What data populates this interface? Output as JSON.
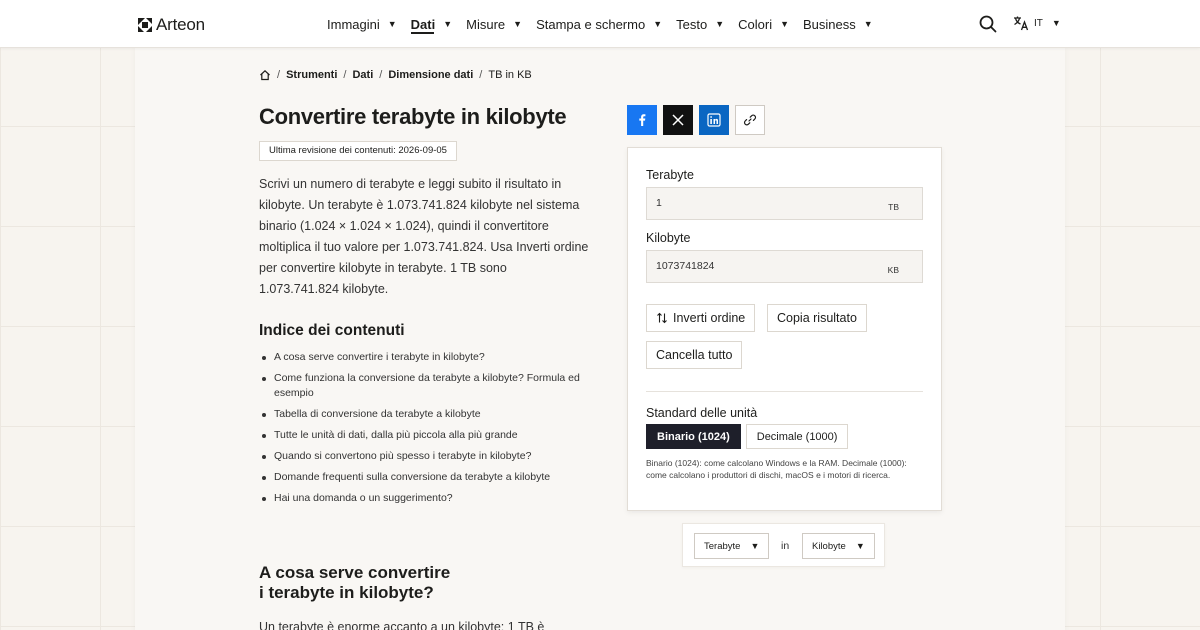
{
  "header": {
    "logo_text": "Arteon",
    "nav": [
      {
        "label": "Immagini",
        "active": false
      },
      {
        "label": "Dati",
        "active": true
      },
      {
        "label": "Misure",
        "active": false
      },
      {
        "label": "Stampa e schermo",
        "active": false
      },
      {
        "label": "Testo",
        "active": false
      },
      {
        "label": "Colori",
        "active": false
      },
      {
        "label": "Business",
        "active": false
      }
    ],
    "language": "IT"
  },
  "breadcrumb": {
    "items": [
      "Strumenti",
      "Dati",
      "Dimensione dati"
    ],
    "current": "TB in KB"
  },
  "page_title": "Convertire terabyte in kilobyte",
  "revision": "Ultima revisione dei contenuti: 2026-09-05",
  "intro": "Scrivi un numero di terabyte e leggi subito il risultato in kilobyte. Un terabyte è 1.073.741.824 kilobyte nel sistema binario (1.024 × 1.024 × 1.024), quindi il convertitore moltiplica il tuo valore per 1.073.741.824. Usa Inverti ordine per convertire kilobyte in terabyte. 1 TB sono 1.073.741.824 kilobyte.",
  "toc": {
    "title": "Indice dei contenuti",
    "items": [
      "A cosa serve convertire i terabyte in kilobyte?",
      "Come funziona la conversione da terabyte a kilobyte? Formula ed esempio",
      "Tabella di conversione da terabyte a kilobyte",
      "Tutte le unità di dati, dalla più piccola alla più grande",
      "Quando si convertono più spesso i terabyte in kilobyte?",
      "Domande frequenti sulla conversione da terabyte a kilobyte",
      "Hai una domanda o un suggerimento?"
    ]
  },
  "section": {
    "heading_line1": "A cosa serve convertire",
    "heading_line2": "i terabyte in kilobyte?",
    "text": "Un terabyte è enorme accanto a un kilobyte: 1 TB è"
  },
  "share": {
    "icons": [
      "facebook-icon",
      "x-icon",
      "linkedin-icon",
      "link-icon"
    ]
  },
  "converter": {
    "from_label": "Terabyte",
    "from_value": "1",
    "from_unit": "TB",
    "to_label": "Kilobyte",
    "to_value": "1073741824",
    "to_unit": "KB",
    "swap_label": "Inverti ordine",
    "copy_label": "Copia risultato",
    "clear_label": "Cancella tutto",
    "standard_label": "Standard delle unità",
    "binary_label": "Binario (1024)",
    "decimal_label": "Decimale (1000)",
    "standard_note": "Binario (1024): come calcolano Windows e la RAM. Decimale (1000): come calcolano i produttori di dischi, macOS e i motori di ricerca."
  },
  "pair": {
    "from": "Terabyte",
    "in": "in",
    "to": "Kilobyte"
  },
  "colors": {
    "accent_dark": "#1e1f2a",
    "facebook": "#1877f2",
    "linkedin": "#0a66c2"
  }
}
